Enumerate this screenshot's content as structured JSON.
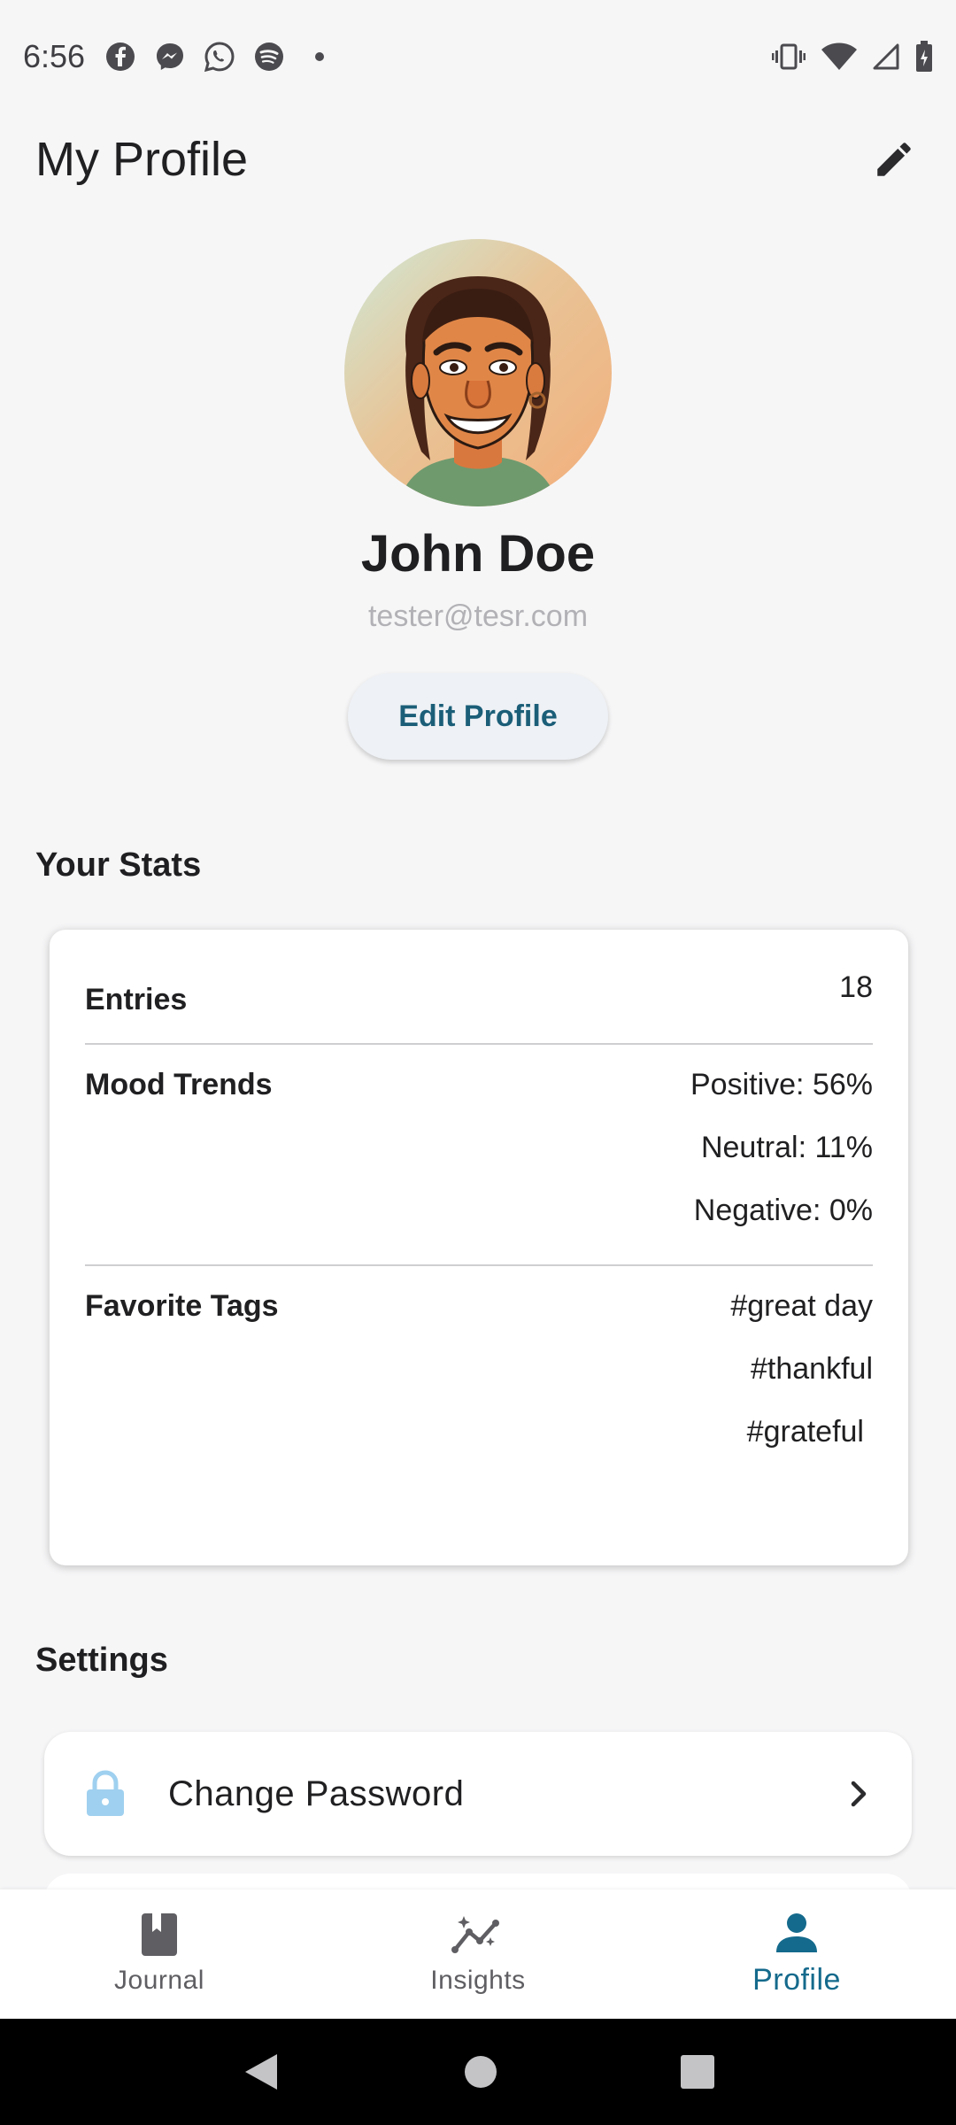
{
  "status_bar": {
    "time": "6:56",
    "icons_left": [
      "facebook-icon",
      "messenger-icon",
      "whatsapp-icon",
      "spotify-icon"
    ],
    "icons_right": [
      "vibrate-icon",
      "wifi-icon",
      "signal-icon",
      "battery-icon"
    ]
  },
  "header": {
    "title": "My Profile",
    "edit_icon": "pencil-icon"
  },
  "profile": {
    "name": "John Doe",
    "email": "tester@tesr.com",
    "edit_button": "Edit Profile"
  },
  "stats": {
    "section_title": "Your Stats",
    "entries_label": "Entries",
    "entries_value": "18",
    "mood_label": "Mood Trends",
    "mood_values": [
      "Positive: 56%",
      "Neutral: 11%",
      "Negative: 0%"
    ],
    "tags_label": "Favorite Tags",
    "tags": [
      "#great day",
      "#thankful",
      "#grateful"
    ]
  },
  "settings": {
    "section_title": "Settings",
    "items": [
      {
        "label": "Change Password",
        "icon": "lock-icon"
      }
    ]
  },
  "bottom_nav": {
    "items": [
      {
        "label": "Journal",
        "icon": "book-icon"
      },
      {
        "label": "Insights",
        "icon": "insights-icon"
      },
      {
        "label": "Profile",
        "icon": "person-icon"
      }
    ],
    "active_color": "#146a8c",
    "inactive_color": "#5f5f63"
  }
}
